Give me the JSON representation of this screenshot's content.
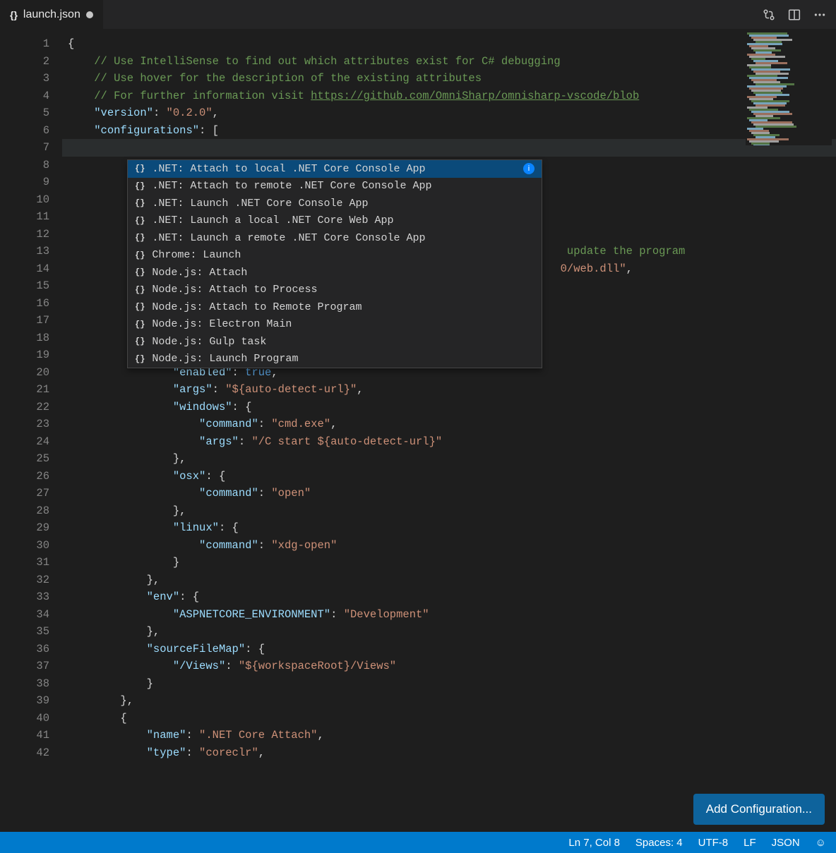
{
  "tab": {
    "icon": "{}",
    "title": "launch.json",
    "dirty": true
  },
  "titlebar_actions": {
    "git_compare": "git-compare-icon",
    "split": "split-editor-icon",
    "more": "more-icon"
  },
  "lines": [
    {
      "n": 1,
      "segs": [
        {
          "t": "{",
          "c": "c-punct"
        }
      ]
    },
    {
      "n": 2,
      "indent": "    ",
      "segs": [
        {
          "t": "// Use IntelliSense to find out which attributes exist for C# debugging",
          "c": "c-comment"
        }
      ]
    },
    {
      "n": 3,
      "indent": "    ",
      "segs": [
        {
          "t": "// Use hover for the description of the existing attributes",
          "c": "c-comment"
        }
      ]
    },
    {
      "n": 4,
      "indent": "    ",
      "segs": [
        {
          "t": "// For further information visit ",
          "c": "c-comment"
        },
        {
          "t": "https://github.com/OmniSharp/omnisharp-vscode/blob",
          "c": "c-link"
        }
      ]
    },
    {
      "n": 5,
      "indent": "    ",
      "segs": [
        {
          "t": "\"version\"",
          "c": "c-key"
        },
        {
          "t": ": ",
          "c": "c-punct"
        },
        {
          "t": "\"0.2.0\"",
          "c": "c-str"
        },
        {
          "t": ",",
          "c": "c-punct"
        }
      ]
    },
    {
      "n": 6,
      "indent": "    ",
      "segs": [
        {
          "t": "\"configurations\"",
          "c": "c-key"
        },
        {
          "t": ": [",
          "c": "c-punct"
        }
      ]
    },
    {
      "n": 7,
      "hl": true,
      "segs": []
    },
    {
      "n": 8,
      "segs": []
    },
    {
      "n": 9,
      "segs": []
    },
    {
      "n": 10,
      "segs": []
    },
    {
      "n": 11,
      "segs": []
    },
    {
      "n": 12,
      "segs": []
    },
    {
      "n": 13,
      "indent": "                                                                            ",
      "segs": [
        {
          "t": "update the program",
          "c": "c-comment"
        }
      ]
    },
    {
      "n": 14,
      "indent": "                                                                           ",
      "segs": [
        {
          "t": "0/web.dll\"",
          "c": "c-str"
        },
        {
          "t": ",",
          "c": "c-punct"
        }
      ]
    },
    {
      "n": 15,
      "segs": []
    },
    {
      "n": 16,
      "segs": []
    },
    {
      "n": 17,
      "segs": []
    },
    {
      "n": 18,
      "segs": []
    },
    {
      "n": 19,
      "segs": []
    },
    {
      "n": 20,
      "indent": "                ",
      "segs": [
        {
          "t": "\"enabled\"",
          "c": "c-key"
        },
        {
          "t": ": ",
          "c": "c-punct"
        },
        {
          "t": "true",
          "c": "c-bool"
        },
        {
          "t": ",",
          "c": "c-punct"
        }
      ]
    },
    {
      "n": 21,
      "indent": "                ",
      "segs": [
        {
          "t": "\"args\"",
          "c": "c-key"
        },
        {
          "t": ": ",
          "c": "c-punct"
        },
        {
          "t": "\"${auto-detect-url}\"",
          "c": "c-str"
        },
        {
          "t": ",",
          "c": "c-punct"
        }
      ]
    },
    {
      "n": 22,
      "indent": "                ",
      "segs": [
        {
          "t": "\"windows\"",
          "c": "c-key"
        },
        {
          "t": ": {",
          "c": "c-punct"
        }
      ]
    },
    {
      "n": 23,
      "indent": "                    ",
      "segs": [
        {
          "t": "\"command\"",
          "c": "c-key"
        },
        {
          "t": ": ",
          "c": "c-punct"
        },
        {
          "t": "\"cmd.exe\"",
          "c": "c-str"
        },
        {
          "t": ",",
          "c": "c-punct"
        }
      ]
    },
    {
      "n": 24,
      "indent": "                    ",
      "segs": [
        {
          "t": "\"args\"",
          "c": "c-key"
        },
        {
          "t": ": ",
          "c": "c-punct"
        },
        {
          "t": "\"/C start ${auto-detect-url}\"",
          "c": "c-str"
        }
      ]
    },
    {
      "n": 25,
      "indent": "                ",
      "segs": [
        {
          "t": "},",
          "c": "c-punct"
        }
      ]
    },
    {
      "n": 26,
      "indent": "                ",
      "segs": [
        {
          "t": "\"osx\"",
          "c": "c-key"
        },
        {
          "t": ": {",
          "c": "c-punct"
        }
      ]
    },
    {
      "n": 27,
      "indent": "                    ",
      "segs": [
        {
          "t": "\"command\"",
          "c": "c-key"
        },
        {
          "t": ": ",
          "c": "c-punct"
        },
        {
          "t": "\"open\"",
          "c": "c-str"
        }
      ]
    },
    {
      "n": 28,
      "indent": "                ",
      "segs": [
        {
          "t": "},",
          "c": "c-punct"
        }
      ]
    },
    {
      "n": 29,
      "indent": "                ",
      "segs": [
        {
          "t": "\"linux\"",
          "c": "c-key"
        },
        {
          "t": ": {",
          "c": "c-punct"
        }
      ]
    },
    {
      "n": 30,
      "indent": "                    ",
      "segs": [
        {
          "t": "\"command\"",
          "c": "c-key"
        },
        {
          "t": ": ",
          "c": "c-punct"
        },
        {
          "t": "\"xdg-open\"",
          "c": "c-str"
        }
      ]
    },
    {
      "n": 31,
      "indent": "                ",
      "segs": [
        {
          "t": "}",
          "c": "c-punct"
        }
      ]
    },
    {
      "n": 32,
      "indent": "            ",
      "segs": [
        {
          "t": "},",
          "c": "c-punct"
        }
      ]
    },
    {
      "n": 33,
      "indent": "            ",
      "segs": [
        {
          "t": "\"env\"",
          "c": "c-key"
        },
        {
          "t": ": {",
          "c": "c-punct"
        }
      ]
    },
    {
      "n": 34,
      "indent": "                ",
      "segs": [
        {
          "t": "\"ASPNETCORE_ENVIRONMENT\"",
          "c": "c-key"
        },
        {
          "t": ": ",
          "c": "c-punct"
        },
        {
          "t": "\"Development\"",
          "c": "c-str"
        }
      ]
    },
    {
      "n": 35,
      "indent": "            ",
      "segs": [
        {
          "t": "},",
          "c": "c-punct"
        }
      ]
    },
    {
      "n": 36,
      "indent": "            ",
      "segs": [
        {
          "t": "\"sourceFileMap\"",
          "c": "c-key"
        },
        {
          "t": ": {",
          "c": "c-punct"
        }
      ]
    },
    {
      "n": 37,
      "indent": "                ",
      "segs": [
        {
          "t": "\"/Views\"",
          "c": "c-key"
        },
        {
          "t": ": ",
          "c": "c-punct"
        },
        {
          "t": "\"${workspaceRoot}/Views\"",
          "c": "c-str"
        }
      ]
    },
    {
      "n": 38,
      "indent": "            ",
      "segs": [
        {
          "t": "}",
          "c": "c-punct"
        }
      ]
    },
    {
      "n": 39,
      "indent": "        ",
      "segs": [
        {
          "t": "},",
          "c": "c-punct"
        }
      ]
    },
    {
      "n": 40,
      "indent": "        ",
      "segs": [
        {
          "t": "{",
          "c": "c-punct"
        }
      ]
    },
    {
      "n": 41,
      "indent": "            ",
      "segs": [
        {
          "t": "\"name\"",
          "c": "c-key"
        },
        {
          "t": ": ",
          "c": "c-punct"
        },
        {
          "t": "\".NET Core Attach\"",
          "c": "c-str"
        },
        {
          "t": ",",
          "c": "c-punct"
        }
      ]
    },
    {
      "n": 42,
      "indent": "            ",
      "segs": [
        {
          "t": "\"type\"",
          "c": "c-key"
        },
        {
          "t": ": ",
          "c": "c-punct"
        },
        {
          "t": "\"coreclr\"",
          "c": "c-str"
        },
        {
          "t": ",",
          "c": "c-punct"
        }
      ]
    }
  ],
  "suggest": {
    "items": [
      {
        "icon": "{}",
        "label": ".NET: Attach to local .NET Core Console App",
        "selected": true,
        "info": true
      },
      {
        "icon": "{}",
        "label": ".NET: Attach to remote .NET Core Console App"
      },
      {
        "icon": "{}",
        "label": ".NET: Launch .NET Core Console App"
      },
      {
        "icon": "{}",
        "label": ".NET: Launch a local .NET Core Web App"
      },
      {
        "icon": "{}",
        "label": ".NET: Launch a remote .NET Core Console App"
      },
      {
        "icon": "{}",
        "label": "Chrome: Launch"
      },
      {
        "icon": "{}",
        "label": "Node.js: Attach"
      },
      {
        "icon": "{}",
        "label": "Node.js: Attach to Process"
      },
      {
        "icon": "{}",
        "label": "Node.js: Attach to Remote Program"
      },
      {
        "icon": "{}",
        "label": "Node.js: Electron Main"
      },
      {
        "icon": "{}",
        "label": "Node.js: Gulp task"
      },
      {
        "icon": "{}",
        "label": "Node.js: Launch Program"
      }
    ]
  },
  "add_config_button": "Add Configuration...",
  "statusbar": {
    "cursor": "Ln 7, Col 8",
    "spaces": "Spaces: 4",
    "encoding": "UTF-8",
    "eol": "LF",
    "language": "JSON",
    "feedback": "☺"
  }
}
